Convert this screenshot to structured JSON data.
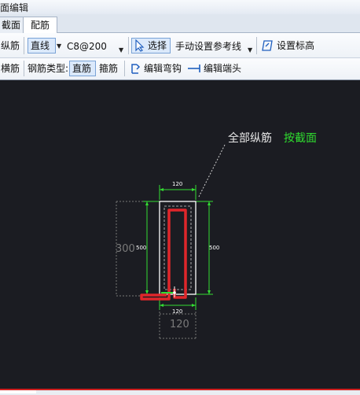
{
  "window": {
    "title": "面编辑"
  },
  "tabs": [
    {
      "label": "截面",
      "active": false
    },
    {
      "label": "配筋",
      "active": true
    }
  ],
  "toolbar1": {
    "longitudinal_label": "纵筋",
    "line_mode": "直线",
    "rebar_spec": "C8@200",
    "select_label": "选择",
    "ref_line_mode": "手动设置参考线",
    "set_elevation_label": "设置标高"
  },
  "toolbar2": {
    "transverse_label": "横筋",
    "rebar_type_label": "钢筋类型:",
    "straight_label": "直筋",
    "stirrup_label": "箍筋",
    "edit_hook_label": "编辑弯钩",
    "edit_end_label": "编辑端头"
  },
  "drawing": {
    "annotation_label": "全部纵筋",
    "annotation_action": "按截面",
    "dim_top": "120",
    "dim_left_inner": "500",
    "dim_right": "500",
    "dim_bottom_inner": "120",
    "dim_left_outer": "300",
    "dim_bottom_outer": "120",
    "colors": {
      "annotation_action": "#2fdc2f",
      "dimension": "#33dd33",
      "rebar": "#e0262b",
      "outline": "#ffffff",
      "background": "#1b1c22"
    }
  }
}
